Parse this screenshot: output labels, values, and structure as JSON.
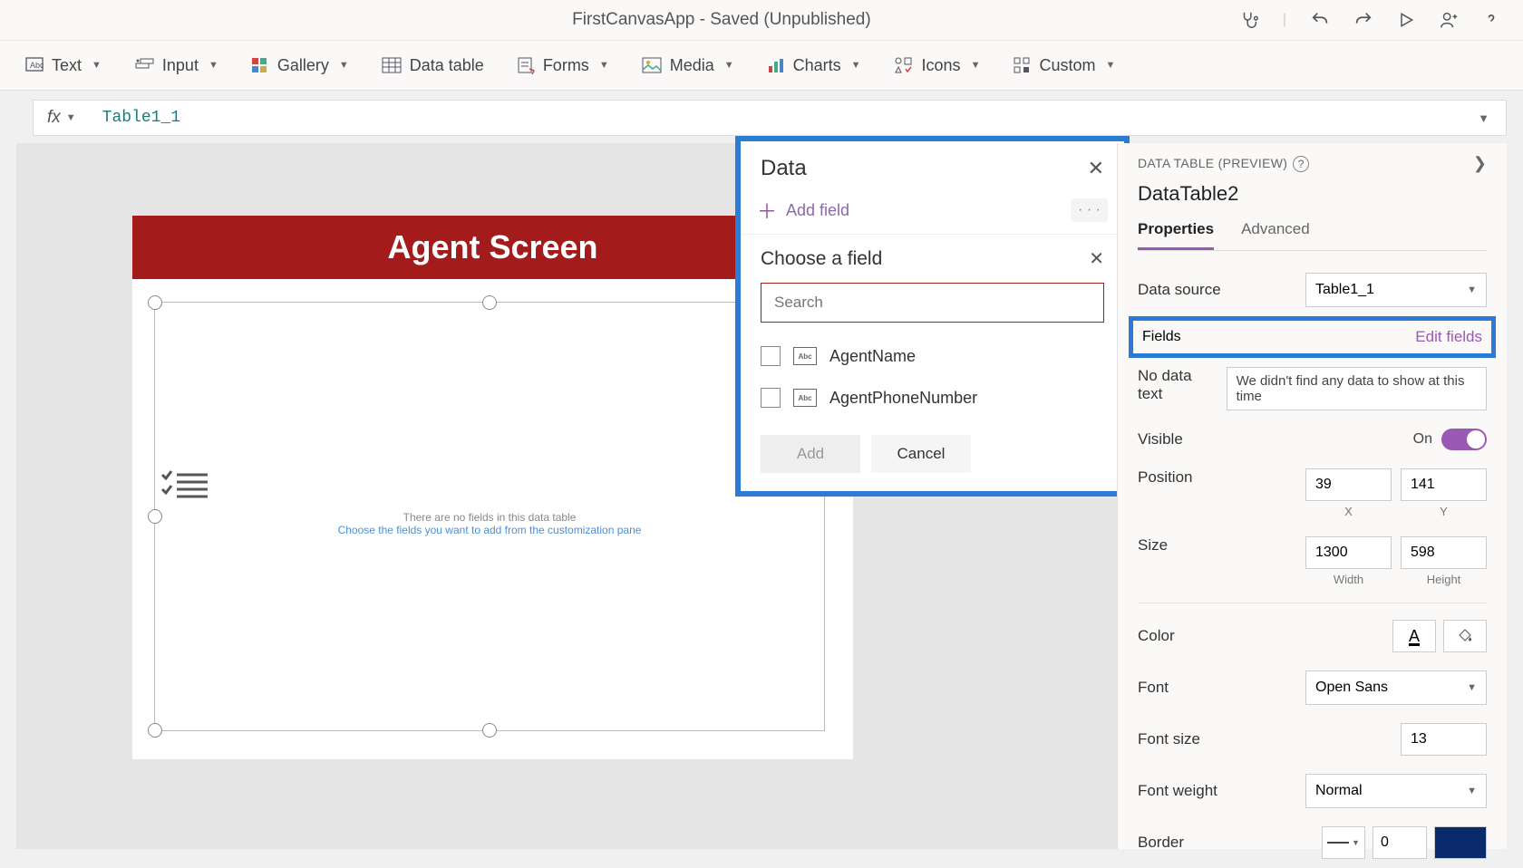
{
  "titlebar": {
    "title": "FirstCanvasApp - Saved (Unpublished)"
  },
  "ribbon": {
    "text": "Text",
    "input": "Input",
    "gallery": "Gallery",
    "datatable": "Data table",
    "forms": "Forms",
    "media": "Media",
    "charts": "Charts",
    "icons": "Icons",
    "custom": "Custom"
  },
  "formula": {
    "fx": "fx",
    "value": "Table1_1"
  },
  "canvas": {
    "header": "Agent Screen",
    "empty1": "There are no fields in this data table",
    "empty2": "Choose the fields you want to add from the customization pane"
  },
  "dataPane": {
    "title": "Data",
    "addField": "Add field",
    "choose": "Choose a field",
    "searchPlaceholder": "Search",
    "fields": [
      "AgentName",
      "AgentPhoneNumber"
    ],
    "add": "Add",
    "cancel": "Cancel"
  },
  "props": {
    "header": "DATA TABLE (PREVIEW)",
    "name": "DataTable2",
    "tabProps": "Properties",
    "tabAdv": "Advanced",
    "dataSource": "Data source",
    "dataSourceVal": "Table1_1",
    "fields": "Fields",
    "editFields": "Edit fields",
    "noData": "No data text",
    "noDataVal": "We didn't find any data to show at this time",
    "visible": "Visible",
    "on": "On",
    "position": "Position",
    "posX": "39",
    "posY": "141",
    "xLbl": "X",
    "yLbl": "Y",
    "size": "Size",
    "width": "1300",
    "height": "598",
    "wLbl": "Width",
    "hLbl": "Height",
    "color": "Color",
    "font": "Font",
    "fontVal": "Open Sans",
    "fontSize": "Font size",
    "fontSizeVal": "13",
    "fontWeight": "Font weight",
    "fontWeightVal": "Normal",
    "border": "Border",
    "borderNum": "0"
  }
}
